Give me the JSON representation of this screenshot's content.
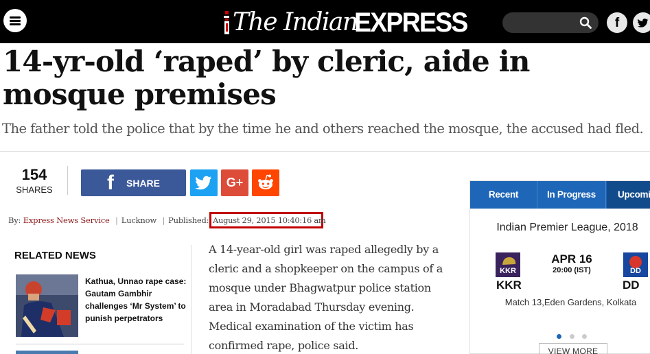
{
  "header": {
    "logo": {
      "prefix": "The Indian",
      "suffix": "EXPRESS"
    },
    "menu_icon": "hamburger-icon",
    "search_icon": "search-icon",
    "social": [
      {
        "icon": "facebook-icon",
        "glyph": "f"
      },
      {
        "icon": "twitter-icon"
      }
    ]
  },
  "article": {
    "headline": "14-yr-old ‘raped’ by cleric, aide in mosque premises",
    "subheadline": "The father told the police that by the time he and others reached the mosque, the accused had fled.",
    "share": {
      "count": "154",
      "count_label": "SHARES",
      "facebook_label": "SHARE",
      "google_label": "G+"
    },
    "byline": {
      "prefix": "By:",
      "author": "Express News Service",
      "location": "Lucknow",
      "published_label": "Published:",
      "date": "August 29, 2015 10:40:16 am"
    },
    "body": "A 14-year-old girl was raped allegedly by a cleric and a shopkeeper on the campus of a mosque under Bhagwatpur police station area in Moradabad Thursday evening. Medical examination of the victim has confirmed rape, police said."
  },
  "related_news": {
    "title": "RELATED NEWS",
    "items": [
      {
        "title": "Kathua, Unnao rape case: Gautam Gambhir challenges ‘Mr System’ to punish perpetrators"
      }
    ]
  },
  "scores_widget": {
    "tabs": [
      "Recent",
      "In Progress",
      "Upcoming"
    ],
    "active_tab": "Upcoming",
    "league": "Indian Premier League, 2018",
    "match": {
      "team1": {
        "abbr": "KKR",
        "logo_text": "KKR",
        "color": "#3a225d"
      },
      "team2": {
        "abbr": "DD",
        "logo_text": "DD",
        "color": "#17479e"
      },
      "date": "APR 16",
      "time": "20:00 (IST)",
      "venue": "Match 13,Eden Gardens, Kolkata"
    },
    "carousel_pages": 3,
    "carousel_active": 1,
    "view_more": "VIEW MORE"
  },
  "colors": {
    "header_bg": "#000000",
    "accent_blue": "#1e66b8",
    "facebook": "#3b5998",
    "twitter": "#1da1f2",
    "googleplus": "#dd4b39",
    "reddit": "#ff4500",
    "highlight_box": "#c00000",
    "author_link": "#8b1a1a"
  }
}
